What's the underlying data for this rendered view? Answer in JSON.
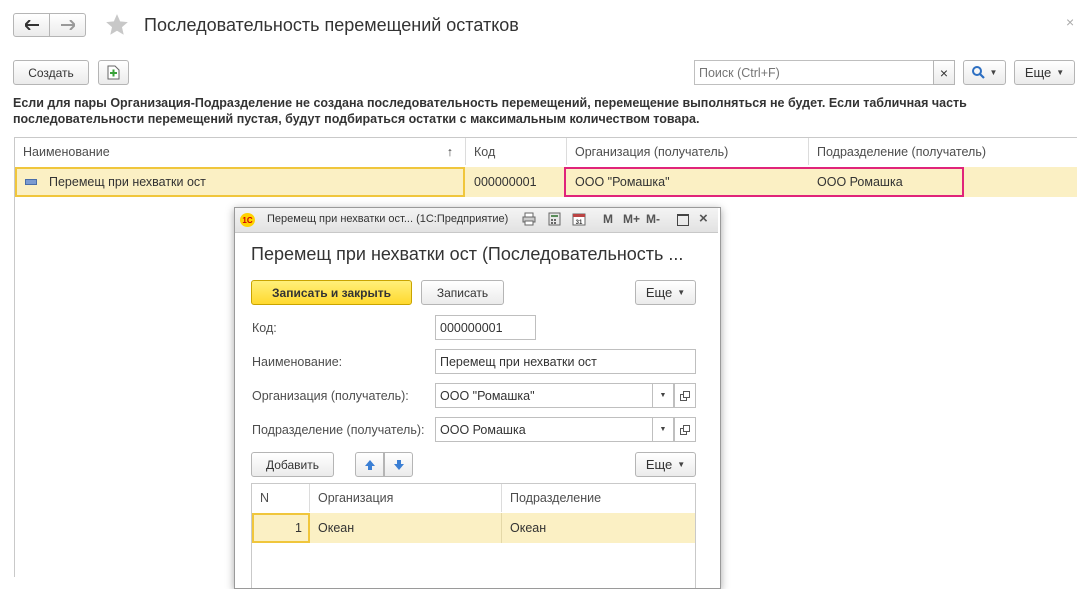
{
  "header": {
    "title": "Последовательность перемещений остатков",
    "back_icon": "arrow-left",
    "forward_icon": "arrow-right",
    "favorite_icon": "star",
    "close_icon": "close"
  },
  "toolbar": {
    "create_label": "Создать",
    "search_placeholder": "Поиск (Ctrl+F)",
    "search_clear": "×",
    "more_label": "Еще"
  },
  "notice": "Если для пары Организация-Подразделение не создана последовательность перемещений, перемещение выполняться не будет. Если табличная часть последовательности перемещений пустая, будут подбираться остатки с максимальным количеством товара.",
  "list": {
    "columns": [
      "Наименование",
      "Код",
      "Организация (получатель)",
      "Подразделение (получатель)"
    ],
    "sort_indicator": "↑",
    "rows": [
      {
        "name": "Перемещ при нехватки ост",
        "code": "000000001",
        "org": "ООО \"Ромашка\"",
        "division": "ООО  Ромашка"
      }
    ]
  },
  "modal": {
    "window_title": "Перемещ при нехватки ост... (1С:Предприятие)",
    "app_icon": "1С",
    "titlebar_buttons": [
      "M",
      "M+",
      "M-"
    ],
    "heading": "Перемещ при нехватки ост (Последовательность ...",
    "save_close_label": "Записать и закрыть",
    "save_label": "Записать",
    "more_label": "Еще",
    "fields": {
      "code_label": "Код:",
      "code_value": "000000001",
      "name_label": "Наименование:",
      "name_value": "Перемещ при нехватки ост",
      "org_label": "Организация (получатель):",
      "org_value": "ООО \"Ромашка\"",
      "division_label": "Подразделение (получатель):",
      "division_value": "ООО  Ромашка"
    },
    "table_toolbar": {
      "add_label": "Добавить",
      "more_label": "Еще"
    },
    "table": {
      "columns": [
        "N",
        "Организация",
        "Подразделение"
      ],
      "rows": [
        {
          "n": "1",
          "org": "Океан",
          "division": "Океан"
        }
      ]
    }
  },
  "colors": {
    "selected_row": "#fbf0c4",
    "highlight_border": "#e0247a",
    "primary_button": "#ffe34d",
    "focus_border": "#f0c63c"
  }
}
